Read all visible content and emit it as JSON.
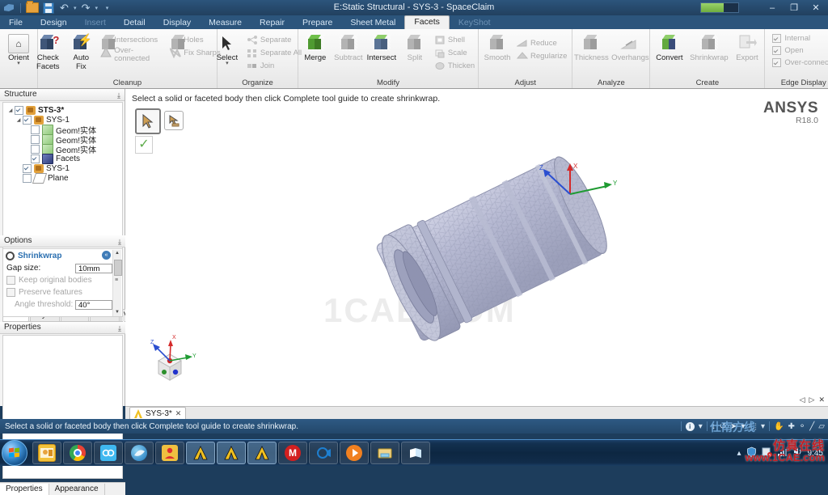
{
  "window": {
    "title": "E:Static Structural - SYS-3 - SpaceClaim",
    "minimize": "–",
    "restore": "❐",
    "close": "✕"
  },
  "quick_access": {
    "app_menu": "spaceclaim-logo",
    "open": "open-icon",
    "save": "save-icon",
    "undo": "↶",
    "redo": "↷",
    "caret": "▾",
    "customize": "☷"
  },
  "ribbon_tabs": [
    {
      "label": "File",
      "state": "normal"
    },
    {
      "label": "Design",
      "state": "normal"
    },
    {
      "label": "Insert",
      "state": "dim"
    },
    {
      "label": "Detail",
      "state": "normal"
    },
    {
      "label": "Display",
      "state": "normal"
    },
    {
      "label": "Measure",
      "state": "normal"
    },
    {
      "label": "Repair",
      "state": "normal"
    },
    {
      "label": "Prepare",
      "state": "normal"
    },
    {
      "label": "Sheet Metal",
      "state": "normal"
    },
    {
      "label": "Facets",
      "state": "active"
    },
    {
      "label": "KeyShot",
      "state": "dim"
    }
  ],
  "ribbon": {
    "orient": {
      "label": "Orient",
      "icon": "home-icon",
      "caret": "▾"
    },
    "cleanup": {
      "title": "Cleanup",
      "big": [
        {
          "label": "Check\nFacets",
          "line1": "Check",
          "line2": "Facets",
          "icon": "check-facets-icon",
          "enabled": true
        },
        {
          "label": "Auto\nFix",
          "line1": "Auto",
          "line2": "Fix",
          "icon": "auto-fix-icon",
          "enabled": true
        }
      ],
      "small": [
        {
          "label": "Intersections",
          "icon": "intersections-icon",
          "enabled": false
        },
        {
          "label": "Over-connected",
          "icon": "over-connected-icon",
          "enabled": false
        },
        {
          "label": "Holes",
          "icon": "holes-icon",
          "enabled": false
        },
        {
          "label": "Fix Sharps",
          "icon": "fix-sharps-icon",
          "enabled": false
        }
      ]
    },
    "organize": {
      "title": "Organize",
      "big": [
        {
          "line1": "Select",
          "line2": "",
          "icon": "select-arrow-icon",
          "enabled": true,
          "caret": "▾"
        }
      ],
      "small": [
        {
          "label": "Separate",
          "icon": "separate-icon",
          "enabled": false
        },
        {
          "label": "Separate All",
          "icon": "separate-all-icon",
          "enabled": false
        },
        {
          "label": "Join",
          "icon": "join-icon",
          "enabled": false
        }
      ]
    },
    "modify": {
      "title": "Modify",
      "big": [
        {
          "line1": "Merge",
          "line2": "",
          "icon": "merge-icon",
          "enabled": true
        },
        {
          "line1": "Subtract",
          "line2": "",
          "icon": "subtract-icon",
          "enabled": false
        },
        {
          "line1": "Intersect",
          "line2": "",
          "icon": "intersect-icon",
          "enabled": true
        },
        {
          "line1": "Split",
          "line2": "",
          "icon": "split-icon",
          "enabled": false
        }
      ],
      "small": [
        {
          "label": "Shell",
          "icon": "shell-icon",
          "enabled": false
        },
        {
          "label": "Scale",
          "icon": "scale-icon",
          "enabled": false
        },
        {
          "label": "Thicken",
          "icon": "thicken-icon",
          "enabled": false
        }
      ]
    },
    "adjust": {
      "title": "Adjust",
      "big": [
        {
          "line1": "Smooth",
          "line2": "",
          "icon": "smooth-icon",
          "enabled": false
        }
      ],
      "small": [
        {
          "label": "Reduce",
          "icon": "reduce-icon",
          "enabled": false
        },
        {
          "label": "Regularize",
          "icon": "regularize-icon",
          "enabled": false
        }
      ]
    },
    "analyze": {
      "title": "Analyze",
      "big": [
        {
          "line1": "Thickness",
          "line2": "",
          "icon": "thickness-icon",
          "enabled": false
        },
        {
          "line1": "Overhangs",
          "line2": "",
          "icon": "overhangs-icon",
          "enabled": false
        }
      ]
    },
    "create": {
      "title": "Create",
      "big": [
        {
          "line1": "Convert",
          "line2": "",
          "icon": "convert-icon",
          "enabled": true
        },
        {
          "line1": "Shrinkwrap",
          "line2": "",
          "icon": "shrinkwrap-icon",
          "enabled": false
        },
        {
          "line1": "Export",
          "line2": "",
          "icon": "export-icon",
          "enabled": false
        }
      ]
    },
    "edge_display": {
      "title": "Edge Display",
      "checks": [
        {
          "label": "Internal",
          "checked": true,
          "enabled": false
        },
        {
          "label": "Open",
          "checked": true,
          "enabled": false
        },
        {
          "label": "Over-connected",
          "checked": true,
          "enabled": false
        }
      ]
    }
  },
  "structure": {
    "header": "Structure",
    "pin": "⤓",
    "nodes": [
      {
        "label": "STS-3*",
        "indent": 0,
        "expander": "◢",
        "checked": true,
        "icon": "assembly-icon",
        "bold": true
      },
      {
        "label": "SYS-1",
        "indent": 1,
        "expander": "◢",
        "checked": true,
        "icon": "component-icon",
        "bold": false
      },
      {
        "label": "Geom!实体",
        "indent": 2,
        "expander": "",
        "checked": false,
        "icon": "solid-icon",
        "bold": false
      },
      {
        "label": "Geom!实体",
        "indent": 2,
        "expander": "",
        "checked": false,
        "icon": "solid-icon",
        "bold": false
      },
      {
        "label": "Geom!实体",
        "indent": 2,
        "expander": "",
        "checked": false,
        "icon": "solid-icon",
        "bold": false
      },
      {
        "label": "Facets",
        "indent": 2,
        "expander": "",
        "checked": true,
        "icon": "facets-icon",
        "bold": false
      },
      {
        "label": "SYS-1",
        "indent": 1,
        "expander": "",
        "checked": true,
        "icon": "component-icon",
        "bold": false
      },
      {
        "label": "Plane",
        "indent": 1,
        "expander": "",
        "checked": false,
        "icon": "plane-icon",
        "bold": false
      }
    ],
    "tabs": [
      {
        "label": "Stru...",
        "active": true
      },
      {
        "label": "Laye...",
        "active": false
      },
      {
        "label": "Sele...",
        "active": false
      },
      {
        "label": "Grou...",
        "active": false
      },
      {
        "label": "Views",
        "active": false
      }
    ]
  },
  "options": {
    "header": "Options",
    "pin": "⤓",
    "tool_title": "Shrinkwrap",
    "collapse_icon": "«",
    "rows": [
      {
        "label": "Gap size:",
        "value": "10mm",
        "type": "field",
        "enabled": true
      },
      {
        "label": "Keep original bodies",
        "type": "checkbox",
        "checked": false,
        "enabled": false
      },
      {
        "label": "Preserve features",
        "type": "checkbox",
        "checked": false,
        "enabled": false
      },
      {
        "label": "Angle threshold:",
        "value": "40°",
        "type": "field",
        "enabled": false
      }
    ]
  },
  "properties": {
    "header": "Properties",
    "pin": "⤓",
    "tabs": [
      {
        "label": "Properties",
        "active": true
      },
      {
        "label": "Appearance",
        "active": false
      }
    ]
  },
  "viewport": {
    "prompt": "Select a solid or faceted body then click Complete tool guide to create shrinkwrap.",
    "tool_guide": [
      {
        "name": "select-body-tool",
        "icon": "arrow-cursor-icon",
        "selected": true
      },
      {
        "name": "select-region-tool",
        "icon": "arrow-brush-cursor-icon",
        "selected": false
      }
    ],
    "complete_button": {
      "icon": "green-check-icon",
      "glyph": "✓"
    },
    "logo": {
      "name": "ANSYS",
      "release": "R18.0"
    },
    "watermark": "1CAE.COM",
    "triad_labels": {
      "x": "X",
      "y": "Y",
      "z": "Z"
    },
    "model_triad": {
      "x": "X",
      "y": "Y",
      "z": "Z"
    },
    "nav": {
      "left": "◁",
      "right": "▷",
      "close": "✕"
    }
  },
  "doc_tabs": [
    {
      "label": "SYS-3*",
      "icon": "ansys-a-icon",
      "close": "✕",
      "active": true
    }
  ],
  "statusbar": {
    "text": "Select a solid or faceted body then click Complete tool guide to create shrinkwrap.",
    "info_icon": "i",
    "caret": "▾",
    "icons": [
      {
        "name": "move-updown-icon",
        "glyph": "↕"
      },
      {
        "name": "rotate-icon",
        "glyph": "↺"
      },
      {
        "name": "pointer-icon",
        "glyph": "➤"
      },
      {
        "name": "box-select-icon",
        "glyph": "⬚"
      },
      {
        "name": "pan-hand-icon",
        "glyph": "✋"
      },
      {
        "name": "zoom-fit-icon",
        "glyph": "✚"
      },
      {
        "name": "zoom-icon",
        "glyph": "⚬"
      },
      {
        "name": "section-icon",
        "glyph": "╱"
      },
      {
        "name": "plane-icon",
        "glyph": "▱"
      }
    ],
    "watermark": "仕南方线"
  },
  "taskbar": {
    "start": "start-orb",
    "items": [
      {
        "name": "taskbar-item-outlook",
        "icon": "outlook-icon",
        "state": "pinned"
      },
      {
        "name": "taskbar-item-chrome",
        "icon": "chrome-icon",
        "state": "pinned"
      },
      {
        "name": "taskbar-item-baidu-netdisk",
        "icon": "baidu-netdisk-icon",
        "state": "pinned"
      },
      {
        "name": "taskbar-item-browser",
        "icon": "blue-browser-icon",
        "state": "pinned"
      },
      {
        "name": "taskbar-item-qq",
        "icon": "qq-person-icon",
        "state": "pinned"
      },
      {
        "name": "taskbar-item-ansys-1",
        "icon": "ansys-a-icon",
        "state": "active"
      },
      {
        "name": "taskbar-item-ansys-2",
        "icon": "ansys-a-icon",
        "state": "active"
      },
      {
        "name": "taskbar-item-ansys-3",
        "icon": "ansys-a-icon",
        "state": "active"
      },
      {
        "name": "taskbar-item-mail",
        "icon": "m-circle-icon",
        "state": "pinned"
      },
      {
        "name": "taskbar-item-camera",
        "icon": "camera-icon",
        "state": "pinned"
      },
      {
        "name": "taskbar-item-player",
        "icon": "media-player-icon",
        "state": "pinned"
      },
      {
        "name": "taskbar-item-explorer",
        "icon": "folder-explorer-icon",
        "state": "pinned"
      },
      {
        "name": "taskbar-item-reader",
        "icon": "book-icon",
        "state": "pinned"
      }
    ],
    "tray": [
      {
        "name": "tray-hidden-icon",
        "glyph": "▴"
      },
      {
        "name": "tray-shield-icon",
        "glyph": "⛊"
      },
      {
        "name": "tray-security-icon",
        "glyph": "■"
      },
      {
        "name": "tray-network-icon",
        "glyph": "▰"
      },
      {
        "name": "tray-volume-icon",
        "glyph": "◂"
      }
    ],
    "clock": "9:45"
  },
  "watermark": {
    "site_cn": "仿真在线",
    "site_url": "www.1CAE.com"
  },
  "colors": {
    "title_bar": "#26496c",
    "ribbon_bg": "#f0f0f0",
    "accent_blue": "#2a6fb0",
    "status_bar": "#2a5279",
    "taskbar": "#0d2742",
    "model_body": "#b9bcd4",
    "watermark_red": "#c32026"
  }
}
